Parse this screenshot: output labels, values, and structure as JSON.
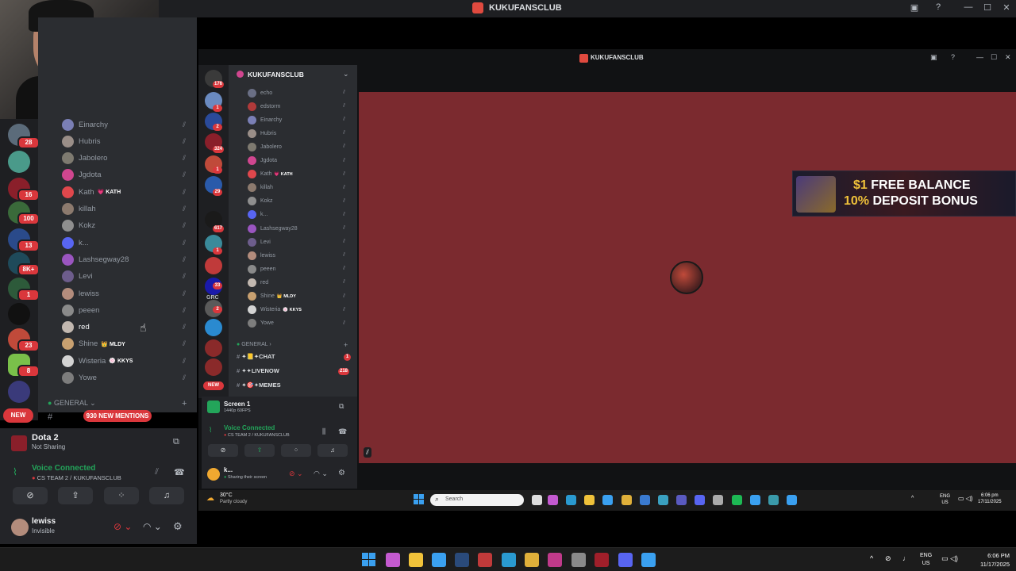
{
  "window": {
    "title": "KUKUFANSCLUB",
    "controls": [
      "—",
      "☐",
      "✕"
    ]
  },
  "left_members": [
    {
      "name": "Einarchy",
      "color": "#7a7fb5"
    },
    {
      "name": "Hubris",
      "color": "#9a8e88"
    },
    {
      "name": "Jabolero",
      "color": "#7e7a70"
    },
    {
      "name": "Jgdota",
      "color": "#d0468f"
    },
    {
      "name": "Kath",
      "tag": "💗 KATH",
      "color": "#e0474c"
    },
    {
      "name": "killah",
      "color": "#8c7a6e"
    },
    {
      "name": "Kokz",
      "color": "#8f8f8f"
    },
    {
      "name": "k...",
      "color": "#5865f2"
    },
    {
      "name": "Lashsegway28",
      "color": "#9a55c0"
    },
    {
      "name": "Levi",
      "color": "#6d5d8c"
    },
    {
      "name": "lewiss",
      "color": "#b38c7c"
    },
    {
      "name": "peeen",
      "color": "#8a8a8a"
    },
    {
      "name": "red",
      "color": "#c2b8b0",
      "highlight": true
    },
    {
      "name": "Shine",
      "tag": "👑 MLDY",
      "color": "#c8a070"
    },
    {
      "name": "Wisteria",
      "tag": "🍥 KKYS",
      "color": "#d3d3d3"
    },
    {
      "name": "Yowe",
      "color": "#7d7d7d"
    }
  ],
  "left_category": "GENERAL",
  "mentions_badge": "930 NEW MENTIONS",
  "new_badge": "NEW",
  "left_rail_badges": [
    "28",
    "16",
    "100",
    "13",
    "8K+",
    "1",
    "23",
    "8"
  ],
  "left_panel": {
    "stream_title": "Dota 2",
    "stream_status": "Not Sharing",
    "voice_status": "Voice Connected",
    "voice_channel": "CS TEAM 2 / KUKUFANSCLUB",
    "user_name": "lewiss",
    "user_status": "Invisible"
  },
  "inner_window": {
    "title": "KUKUFANSCLUB",
    "server_name": "KUKUFANSCLUB",
    "members": [
      {
        "name": "echo",
        "color": "#6a6f85"
      },
      {
        "name": "edstorm",
        "color": "#b03a3a"
      },
      {
        "name": "Einarchy",
        "color": "#7a7fb5"
      },
      {
        "name": "Hubris",
        "color": "#9a8e88"
      },
      {
        "name": "Jabolero",
        "color": "#7e7a70"
      },
      {
        "name": "Jgdota",
        "color": "#d0468f"
      },
      {
        "name": "Kath",
        "tag": "💗 KATH",
        "color": "#e0474c"
      },
      {
        "name": "killah",
        "color": "#8c7a6e"
      },
      {
        "name": "Kokz",
        "color": "#8f8f8f"
      },
      {
        "name": "k...",
        "color": "#5865f2"
      },
      {
        "name": "Lashsegway28",
        "color": "#9a55c0"
      },
      {
        "name": "Levi",
        "color": "#6d5d8c"
      },
      {
        "name": "lewiss",
        "color": "#b38c7c"
      },
      {
        "name": "peeen",
        "color": "#8a8a8a"
      },
      {
        "name": "red",
        "color": "#c2b8b0"
      },
      {
        "name": "Shine",
        "tag": "👑 MLDY",
        "color": "#c8a070"
      },
      {
        "name": "Wisteria",
        "tag": "🍥 KKYS",
        "color": "#d3d3d3"
      },
      {
        "name": "Yowe",
        "color": "#7d7d7d"
      }
    ],
    "category": "GENERAL",
    "channels": [
      {
        "name": "✦📒✦CHAT",
        "badge": "1"
      },
      {
        "name": "✦✦LIVENOW",
        "badge": "218"
      },
      {
        "name": "✦🎯✦MEMES",
        "badge": ""
      }
    ],
    "rail_badges": [
      "176",
      "1",
      "2",
      "324",
      "1",
      "29",
      "617",
      "1",
      "33",
      "2"
    ],
    "rail_label": "GRC",
    "new_badge": "NEW",
    "screen_title": "Screen 1",
    "screen_sub": "1440p 60FPS",
    "voice_status": "Voice Connected",
    "voice_channel": "CS TEAM 2 / KUKUFANSCLUB",
    "user_name": "k...",
    "user_status": "Sharing their screen"
  },
  "ad": {
    "line1_accent": "$1",
    "line1": " FREE BALANCE",
    "line2_accent": "10%",
    "line2": " DEPOSIT BONUS"
  },
  "inner_taskbar": {
    "weather_temp": "30°C",
    "weather_desc": "Partly cloudy",
    "search_placeholder": "Search",
    "lang": "ENG",
    "region": "US",
    "time": "6:06 pm",
    "date": "17/11/2025"
  },
  "taskbar": {
    "lang": "ENG",
    "region": "US",
    "time": "6:06 PM",
    "date": "11/17/2025"
  }
}
